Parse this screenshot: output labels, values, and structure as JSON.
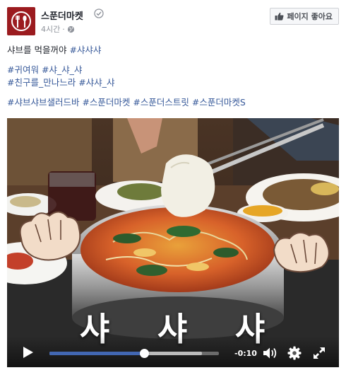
{
  "page": {
    "name": "스푼더마켓",
    "time": "4시간",
    "separator": "·",
    "like_button": "페이지 좋아요"
  },
  "post": {
    "line1": {
      "text": "샤브를 먹을꺼야 ",
      "tag": "#샤샤샤"
    },
    "line2": "#귀여워 #샤_샤_샤",
    "line3": "#친구를_만나느라 #샤샤_샤",
    "line4": "#샤브샤브샐러드바 #스푼더마켓 #스푼더스트릿 #스푼더마켓S"
  },
  "video": {
    "caption_words": [
      "샤",
      "샤",
      "샤"
    ],
    "time_remaining": "-0:10",
    "progress": 0.56,
    "buffered": 0.9
  },
  "colors": {
    "link": "#365899",
    "progress": "#4267b2",
    "brand": "#9b1b1f"
  },
  "icons": [
    "fork-spoon-logo-icon",
    "verified-icon",
    "globe-icon",
    "thumbs-up-icon",
    "play-icon",
    "volume-icon",
    "settings-icon",
    "fullscreen-icon"
  ]
}
